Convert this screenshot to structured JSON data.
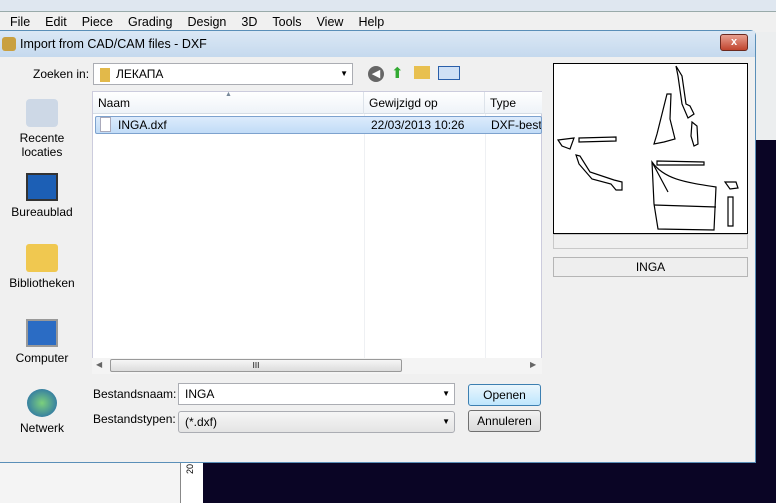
{
  "app": {
    "menu": [
      "File",
      "Edit",
      "Piece",
      "Grading",
      "Design",
      "3D",
      "Tools",
      "View",
      "Help"
    ],
    "ruler_label": "20"
  },
  "dialog": {
    "title": "Import from CAD/CAM files - DXF",
    "close_label": "x",
    "look_in_label": "Zoeken in:",
    "look_in_value": "ЛЕКАПА",
    "sidebar": [
      {
        "label": "Recente locaties",
        "icon": "recent-places-icon"
      },
      {
        "label": "Bureaublad",
        "icon": "desktop-icon"
      },
      {
        "label": "Bibliotheken",
        "icon": "libraries-icon"
      },
      {
        "label": "Computer",
        "icon": "computer-icon"
      },
      {
        "label": "Netwerk",
        "icon": "network-icon"
      }
    ],
    "columns": [
      "Naam",
      "Gewijzigd op",
      "Type"
    ],
    "files": [
      {
        "name": "INGA.dxf",
        "modified": "22/03/2013 10:26",
        "type": "DXF-besta"
      }
    ],
    "scroll_grip": "III",
    "filename_label": "Bestandsnaam:",
    "filename_value": "INGA",
    "filetype_label": "Bestandstypen:",
    "filetype_value": "(*.dxf)",
    "open_label": "Openen",
    "cancel_label": "Annuleren",
    "preview_name": "INGA"
  }
}
